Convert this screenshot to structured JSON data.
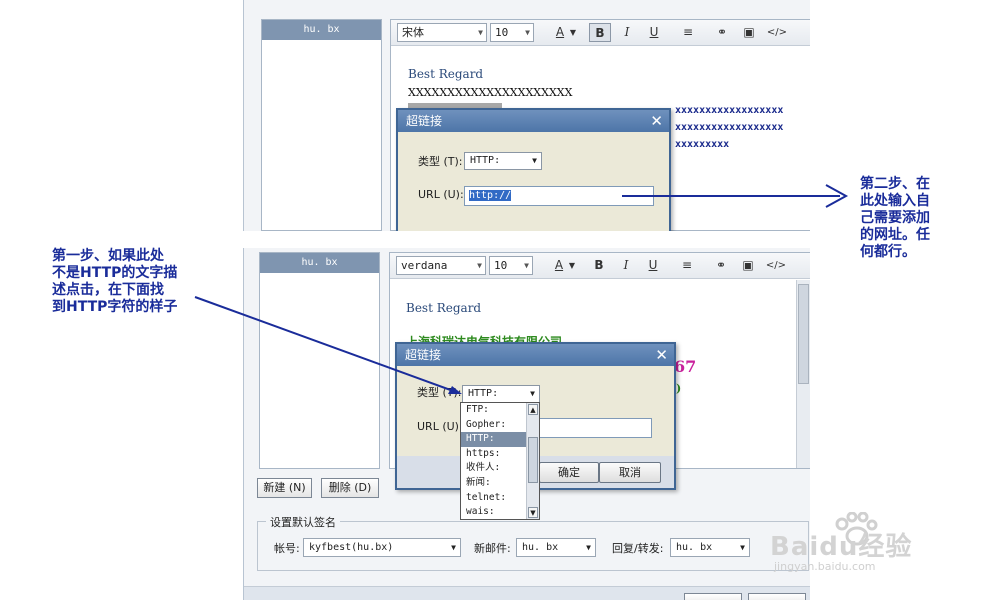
{
  "toolbar_top": {
    "font": "宋体",
    "size": "10"
  },
  "toolbar_bottom": {
    "font": "verdana",
    "size": "10"
  },
  "toolbar_icons": [
    "A",
    "B",
    "I",
    "U",
    "≡",
    "⚭",
    "▣",
    "</>"
  ],
  "sig_list": {
    "item": "hu. bx"
  },
  "signature_top": {
    "greeting": "Best Regard",
    "line1": "XXXXXXXXXXXXXXXXXXXXX",
    "x_lines": [
      "xxxxxxxxxxxxxxxxxx",
      "xxxxxxxxxxxxxxxxxx",
      "xxxxxxxxx"
    ]
  },
  "signature_bottom": {
    "greeting": "Best Regard",
    "company_partial": "上海科瑞达电气科技有限公司",
    "digits": "67",
    "paren": ")"
  },
  "dialog": {
    "title": "超链接",
    "close": "✕",
    "type_label": "类型 (T):",
    "type_value": "HTTP:",
    "url_label": "URL (U):",
    "url_value": "http://",
    "ok": "确定",
    "cancel": "取消"
  },
  "dropdown_options": [
    "FTP:",
    "Gopher:",
    "HTTP:",
    "https:",
    "收件人:",
    "新闻:",
    "telnet:",
    "wais:"
  ],
  "dropdown_selected": "HTTP:",
  "buttons": {
    "new": "新建 (N)",
    "delete": "删除 (D)"
  },
  "defaults": {
    "legend": "设置默认签名",
    "account_label": "帐号:",
    "account_value": "kyfbest(hu.bx)",
    "new_mail_label": "新邮件:",
    "new_mail_value": "hu. bx",
    "reply_label": "回复/转发:",
    "reply_value": "hu. bx"
  },
  "annotations": {
    "step1": [
      "第一步、如果此处",
      "不是HTTP的文字描",
      "述点击，在下面找",
      "到HTTP字符的样子"
    ],
    "step2": [
      "第二步、在",
      "此处输入自",
      "己需要添加",
      "的网址。任",
      "何都行。"
    ]
  },
  "watermark": {
    "brand": "Baidu经验",
    "url": "jingyan.baidu.com"
  },
  "colors": {
    "title_bar": "#4d75a8",
    "annotation": "#1a2c9a",
    "selection": "#316ac5",
    "green_text": "#2d8a1e",
    "magenta_text": "#c9209c"
  }
}
